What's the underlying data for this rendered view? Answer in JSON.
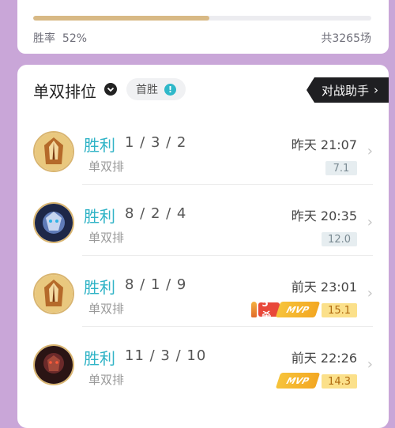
{
  "summary": {
    "winrate_label": "胜率",
    "winrate_value": "52%",
    "winrate_fraction": 0.52,
    "total_games": "共3265场"
  },
  "section": {
    "title": "单双排位",
    "first_win_label": "首胜",
    "assistant_button": "对战助手"
  },
  "matches": [
    {
      "result": "胜利",
      "kda": "1 / 3 / 2",
      "mode": "单双排",
      "time": "昨天 21:07",
      "score": "7.1",
      "score_style": "grey",
      "badges": []
    },
    {
      "result": "胜利",
      "kda": "8 / 2 / 4",
      "mode": "单双排",
      "time": "昨天 20:35",
      "score": "12.0",
      "score_style": "grey",
      "badges": []
    },
    {
      "result": "胜利",
      "kda": "8 / 1 / 9",
      "mode": "单双排",
      "time": "前天 23:01",
      "score": "15.1",
      "score_style": "gold",
      "badges": [
        "5杀",
        "MVP"
      ]
    },
    {
      "result": "胜利",
      "kda": "11 / 3 / 10",
      "mode": "单双排",
      "time": "前天 22:26",
      "score": "14.3",
      "score_style": "gold",
      "badges": [
        "MVP"
      ]
    }
  ],
  "colors": {
    "accent": "#2fb3c6",
    "progress": "#d8b985",
    "background": "#c9a6d8"
  }
}
